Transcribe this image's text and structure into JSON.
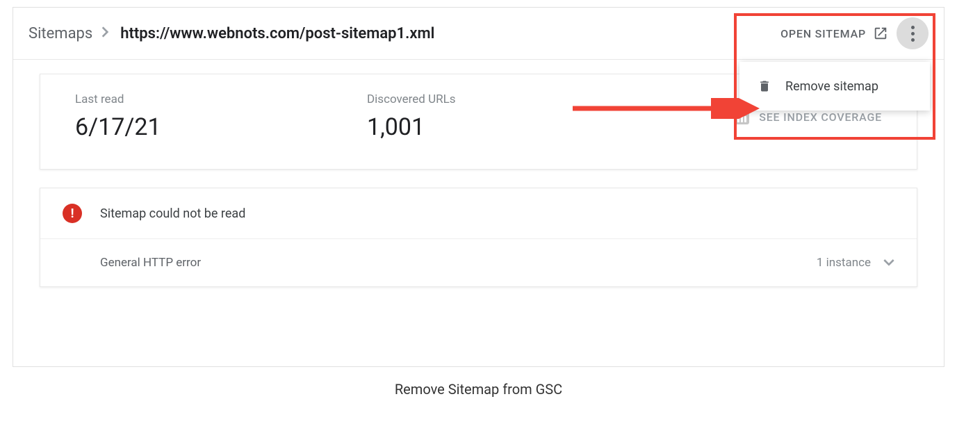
{
  "breadcrumb": {
    "root": "Sitemaps",
    "current": "https://www.webnots.com/post-sitemap1.xml"
  },
  "header": {
    "open_label": "OPEN SITEMAP"
  },
  "dropdown": {
    "remove_label": "Remove sitemap"
  },
  "stats": {
    "last_read_label": "Last read",
    "last_read_value": "6/17/21",
    "discovered_label": "Discovered URLs",
    "discovered_value": "1,001",
    "coverage_label": "SEE INDEX COVERAGE"
  },
  "error": {
    "title": "Sitemap could not be read",
    "detail": "General HTTP error",
    "count": "1 instance"
  },
  "caption": "Remove Sitemap from GSC"
}
